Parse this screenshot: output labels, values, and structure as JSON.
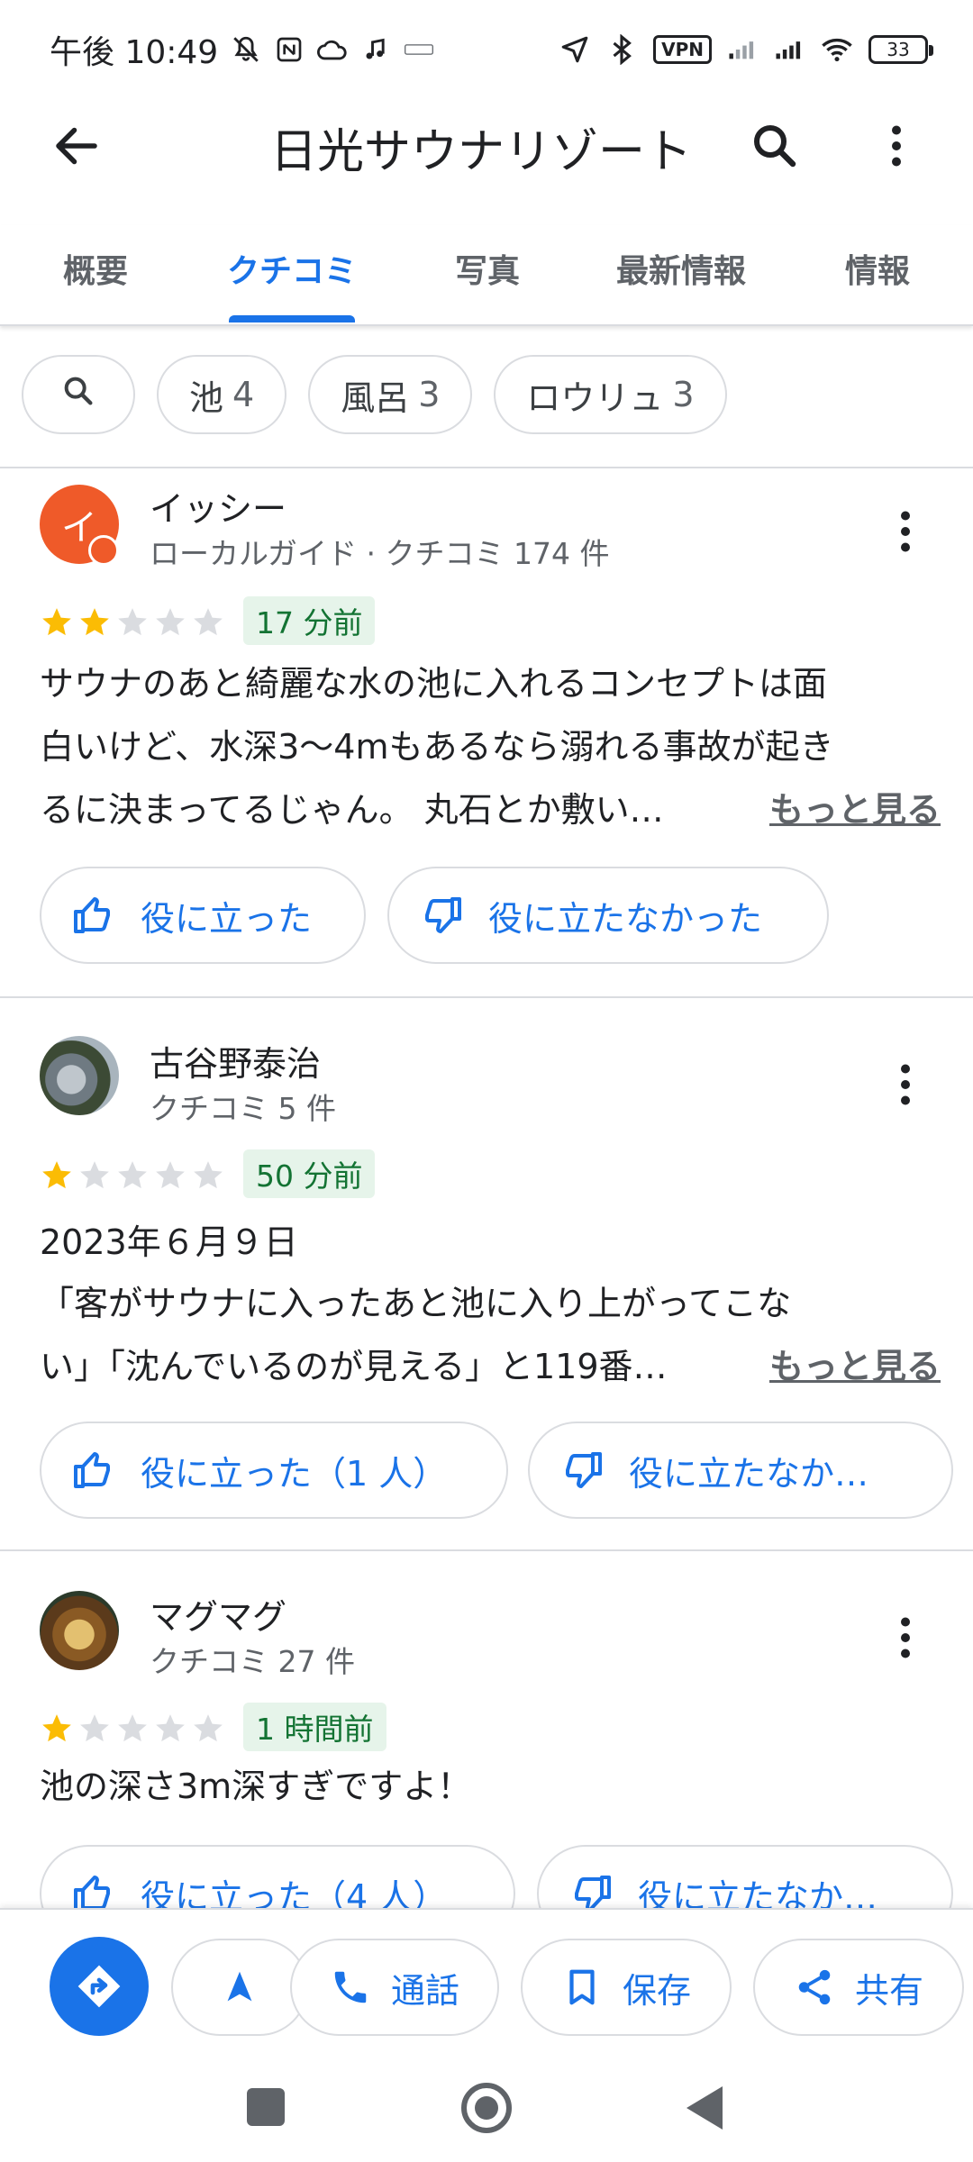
{
  "status_bar": {
    "time": "午後 10:49",
    "vpn": "VPN",
    "battery": "33",
    "icons": [
      "mute-icon",
      "nfc-icon",
      "cloud-icon",
      "music-icon",
      "pay-icon",
      "location-icon",
      "bluetooth-icon",
      "signal-icon",
      "signal-icon",
      "wifi-icon"
    ]
  },
  "app_bar": {
    "title": "日光サウナリゾート"
  },
  "tabs": [
    {
      "label": "概要",
      "active": false
    },
    {
      "label": "クチコミ",
      "active": true
    },
    {
      "label": "写真",
      "active": false
    },
    {
      "label": "最新情報",
      "active": false
    },
    {
      "label": "情報",
      "active": false
    }
  ],
  "filter_chips": [
    {
      "label": "池",
      "count": "4"
    },
    {
      "label": "風呂",
      "count": "3"
    },
    {
      "label": "ロウリュ",
      "count": "3"
    }
  ],
  "reviews": [
    {
      "avatar_letter": "イ",
      "name": "イッシー",
      "meta": "ローカルガイド · クチコミ 174 件",
      "rating": 2,
      "time": "17 分前",
      "date": "",
      "text_lines": [
        "サウナのあと綺麗な水の池に入れるコンセプトは面",
        "白いけど、水深3〜4mもあるなら溺れる事故が起き",
        "るに決まってるじゃん。 丸石とか敷い…"
      ],
      "see_more": "もっと見る",
      "helpful_label": "役に立った",
      "not_helpful_label": "役に立たなかった"
    },
    {
      "avatar_letter": "",
      "name": "古谷野泰治",
      "meta": "クチコミ 5 件",
      "rating": 1,
      "time": "50 分前",
      "date": "2023年６月９日",
      "text_lines": [
        "「客がサウナに入ったあと池に入り上がってこな",
        "い」「沈んでいるのが見える」と119番…"
      ],
      "see_more": "もっと見る",
      "helpful_label": "役に立った（1 人）",
      "not_helpful_label": "役に立たなか…"
    },
    {
      "avatar_letter": "",
      "name": "マグマグ",
      "meta": "クチコミ 27 件",
      "rating": 1,
      "time": "1 時間前",
      "date": "",
      "text_lines": [
        "池の深さ3m深すぎですよ！"
      ],
      "see_more": "",
      "helpful_label": "役に立った（4 人）",
      "not_helpful_label": "役に立たなか…"
    }
  ],
  "bottom_actions": {
    "directions": "directions-icon",
    "navigate": "navigation-arrow-icon",
    "call": "通話",
    "save": "保存",
    "share": "共有"
  },
  "colors": {
    "accent": "#1a73e8",
    "star": "#fbbc04",
    "time_badge_bg": "#e6f4ea",
    "time_badge_text": "#137333",
    "avatar_orange": "#ef5a29"
  }
}
